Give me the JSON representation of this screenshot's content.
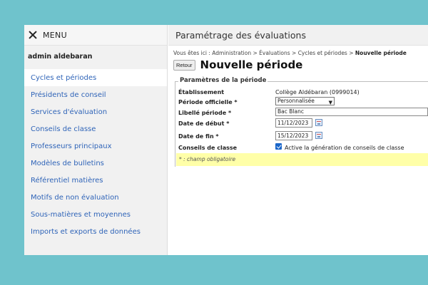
{
  "menu": {
    "close_icon": "close-icon",
    "label": "MENU"
  },
  "sidebar": {
    "user": "admin aldebaran",
    "items": [
      {
        "label": "Cycles et périodes",
        "active": true
      },
      {
        "label": "Présidents de conseil"
      },
      {
        "label": "Services d'évaluation"
      },
      {
        "label": "Conseils de classe"
      },
      {
        "label": "Professeurs principaux"
      },
      {
        "label": "Modèles de bulletins"
      },
      {
        "label": "Référentiel matières"
      },
      {
        "label": "Motifs de non évaluation"
      },
      {
        "label": "Sous-matières et moyennes"
      },
      {
        "label": "Imports et exports de données"
      }
    ]
  },
  "header": {
    "title": "Paramétrage des évaluations"
  },
  "breadcrumb": {
    "prefix": "Vous êtes ici : Administration > Évaluations > Cycles et périodes >",
    "current": "Nouvelle période"
  },
  "page": {
    "back_label": "Retour",
    "title": "Nouvelle période"
  },
  "form": {
    "legend": "Paramètres de la période",
    "etablissement_label": "Établissement",
    "etablissement_value": "Collège Aldébaran (0999014)",
    "periode_label": "Période officielle *",
    "periode_value": "Personnalisée",
    "libelle_label": "Libellé période *",
    "libelle_value": "Bac Blanc",
    "debut_label": "Date de début *",
    "debut_value": "11/12/2023",
    "fin_label": "Date de fin *",
    "fin_value": "15/12/2023",
    "conseils_label": "Conseils de classe",
    "conseils_checked": true,
    "conseils_check_label": "Active la génération de conseils de classe",
    "required_note": "* : champ obligatoire"
  },
  "colors": {
    "background": "#6fc3cc",
    "link": "#2f64b8",
    "note_bg": "#ffffa8",
    "checkbox": "#1b66c9"
  }
}
